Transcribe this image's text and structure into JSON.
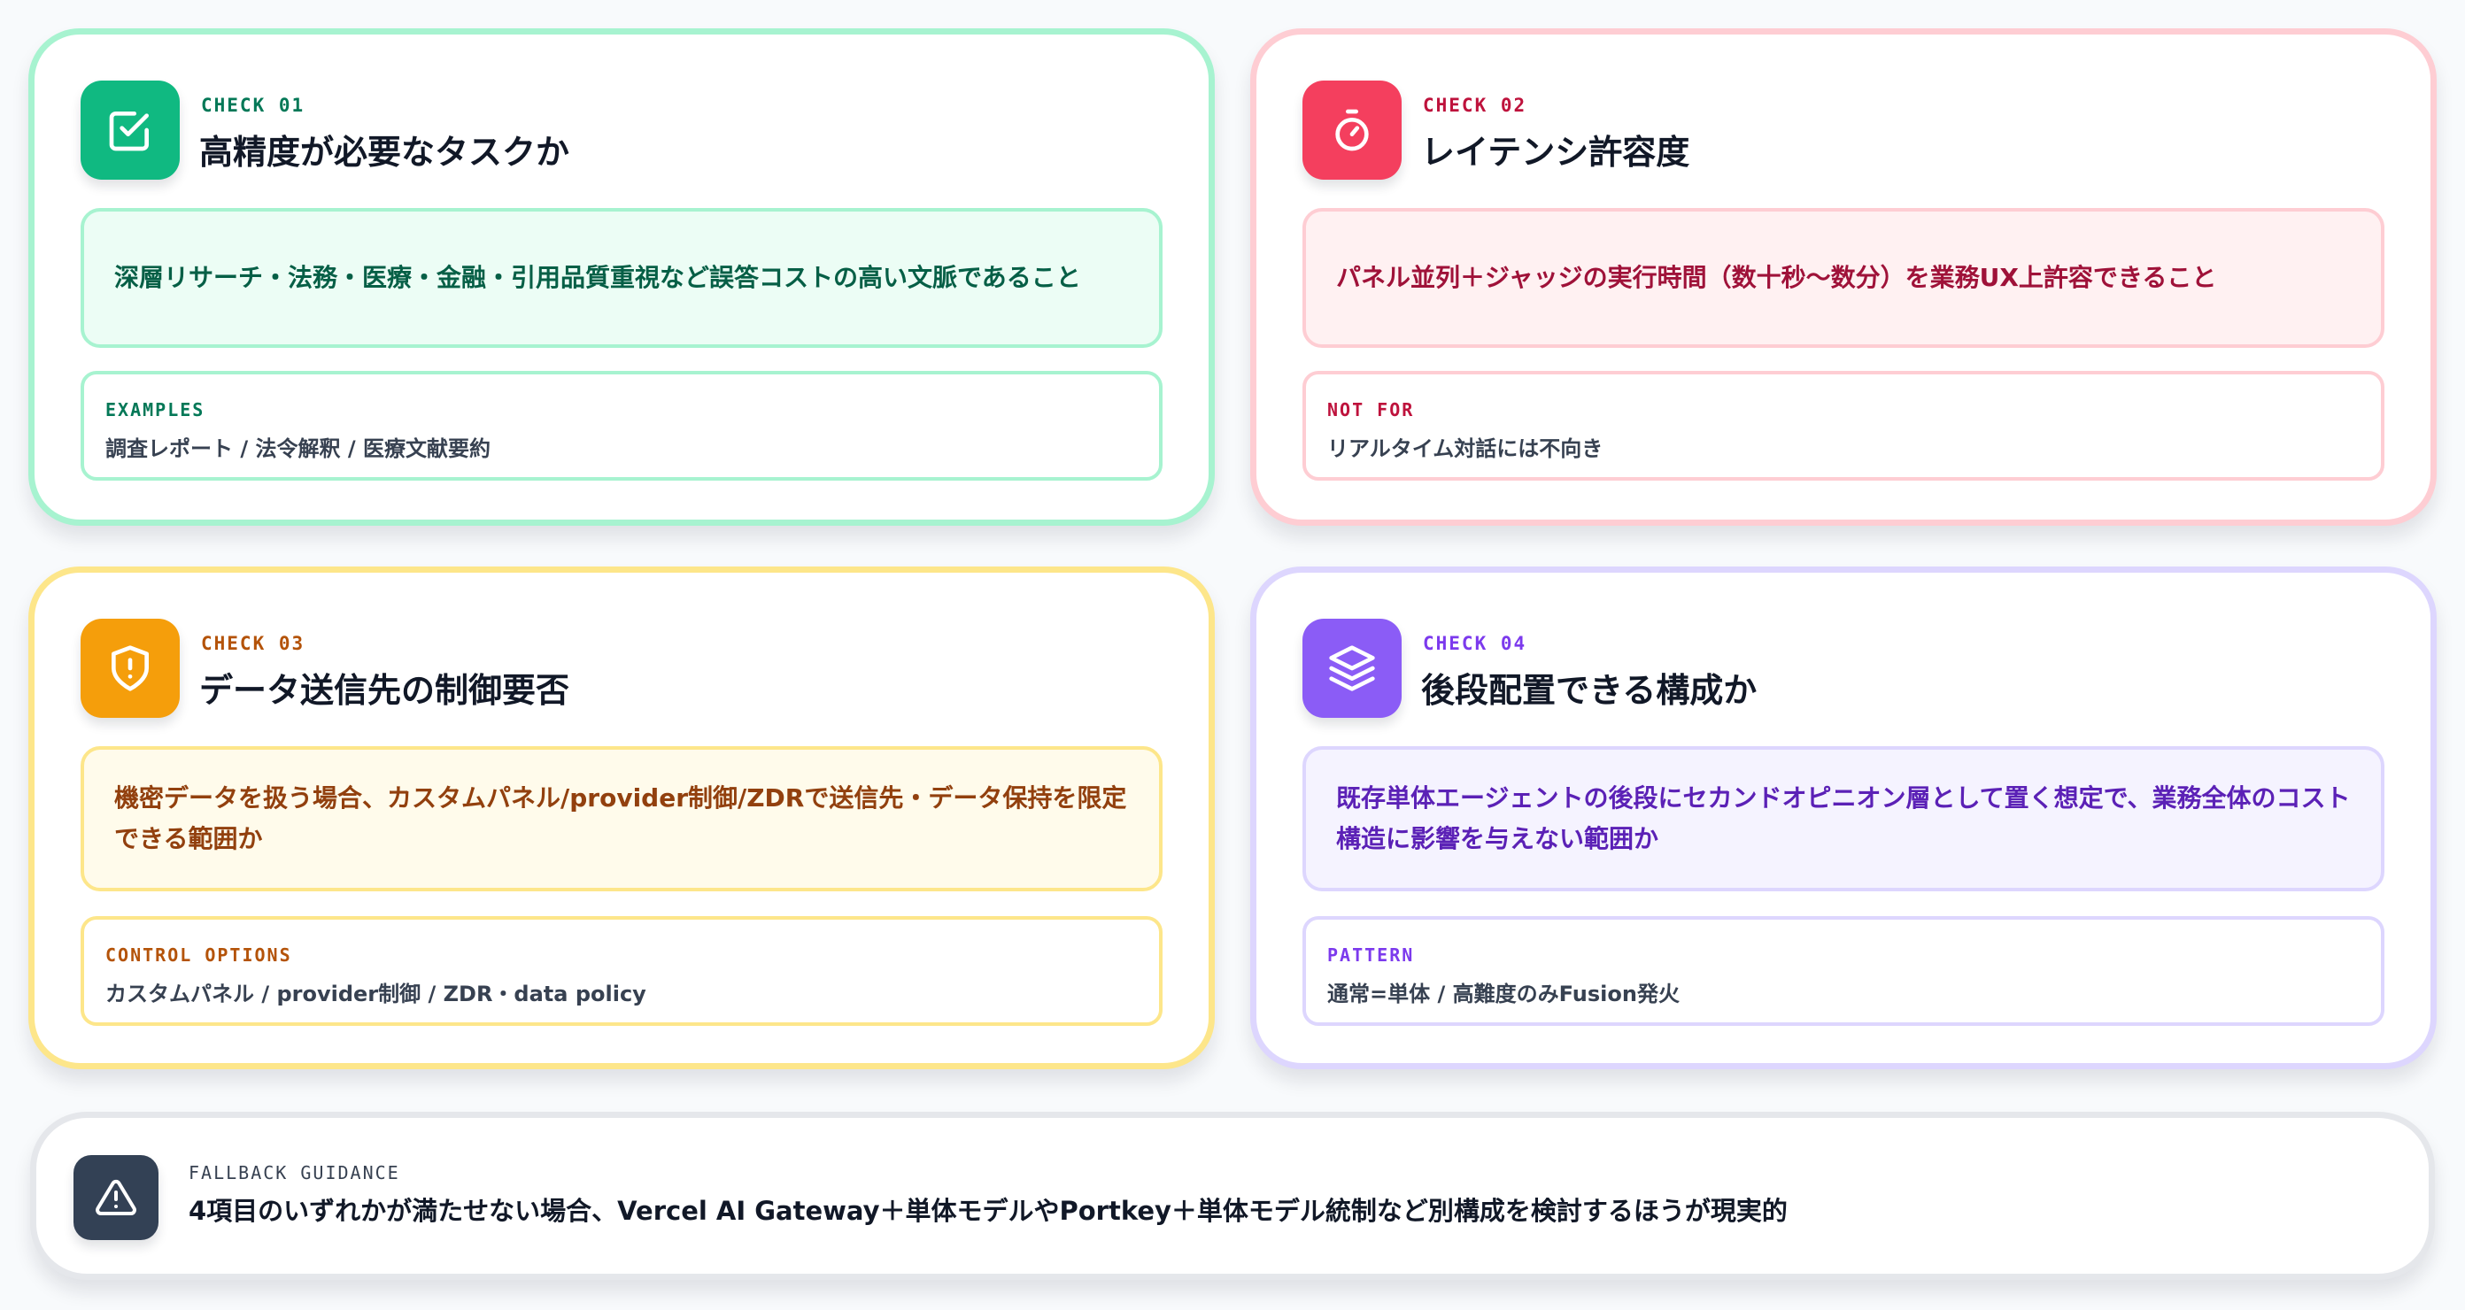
{
  "cards": [
    {
      "check": "CHECK 01",
      "title": "高精度が必要なタスクか",
      "icon": "check-square-icon",
      "requirement": "深層リサーチ・法務・医療・金融・引用品質重視など誤答コストの高い文脈であること",
      "sub_label": "EXAMPLES",
      "sub_text": "調査レポート / 法令解釈 / 医療文献要約",
      "colors": {
        "accent": "#10b981",
        "label": "#047857",
        "border": "#a7f3d0",
        "box_bg": "#ecfdf5",
        "box_border": "#a7f3d0",
        "box_text": "#065f46"
      }
    },
    {
      "check": "CHECK 02",
      "title": "レイテンシ許容度",
      "icon": "stopwatch-icon",
      "requirement": "パネル並列＋ジャッジの実行時間（数十秒〜数分）を業務UX上許容できること",
      "sub_label": "NOT FOR",
      "sub_text": "リアルタイム対話には不向き",
      "colors": {
        "accent": "#f43f5e",
        "label": "#be123c",
        "border": "#fecdd3",
        "box_bg": "#fff1f2",
        "box_border": "#fecdd3",
        "box_text": "#9f1239"
      }
    },
    {
      "check": "CHECK 03",
      "title": "データ送信先の制御要否",
      "icon": "shield-alert-icon",
      "requirement": "機密データを扱う場合、カスタムパネル/provider制御/ZDRで送信先・データ保持を限定できる範囲か",
      "sub_label": "CONTROL OPTIONS",
      "sub_text": "カスタムパネル / provider制御 / ZDR・data policy",
      "colors": {
        "accent": "#f59e0b",
        "label": "#b45309",
        "border": "#fde68a",
        "box_bg": "#fffbeb",
        "box_border": "#fde68a",
        "box_text": "#92400e"
      }
    },
    {
      "check": "CHECK 04",
      "title": "後段配置できる構成か",
      "icon": "layers-icon",
      "requirement": "既存単体エージェントの後段にセカンドオピニオン層として置く想定で、業務全体のコスト構造に影響を与えない範囲か",
      "sub_label": "PATTERN",
      "sub_text": "通常=単体 / 高難度のみFusion発火",
      "colors": {
        "accent": "#8b5cf6",
        "label": "#7c3aed",
        "border": "#ddd6fe",
        "box_bg": "#f5f3ff",
        "box_border": "#ddd6fe",
        "box_text": "#5b21b6"
      }
    }
  ],
  "fallback": {
    "icon": "warning-triangle-icon",
    "label": "FALLBACK GUIDANCE",
    "text": "4項目のいずれかが満たせない場合、Vercel AI Gateway＋単体モデルやPortkey＋単体モデル統制など別構成を検討するほうが現実的"
  }
}
